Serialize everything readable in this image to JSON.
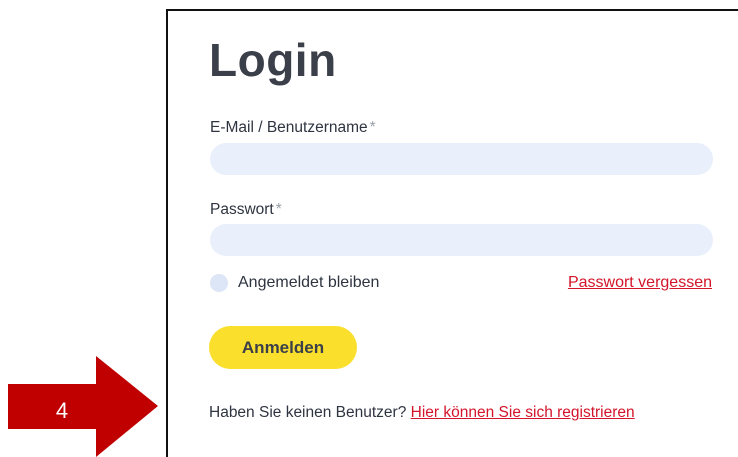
{
  "login": {
    "title": "Login",
    "email": {
      "label": "E-Mail / Benutzername",
      "required_mark": "*",
      "value": "",
      "placeholder": ""
    },
    "password": {
      "label": "Passwort",
      "required_mark": "*",
      "value": "",
      "placeholder": ""
    },
    "remember_label": "Angemeldet bleiben",
    "forgot_link": "Passwort vergessen",
    "submit_label": "Anmelden",
    "register_prompt": "Haben Sie keinen Benutzer?",
    "register_link": "Hier können Sie sich registrieren"
  },
  "annotation": {
    "step_number": "4",
    "arrow_color": "#c00000"
  },
  "colors": {
    "accent_yellow": "#fadf2c",
    "link_red": "#d4142a",
    "input_bg": "#e9f0fb",
    "title_text": "#3a3f4a"
  }
}
